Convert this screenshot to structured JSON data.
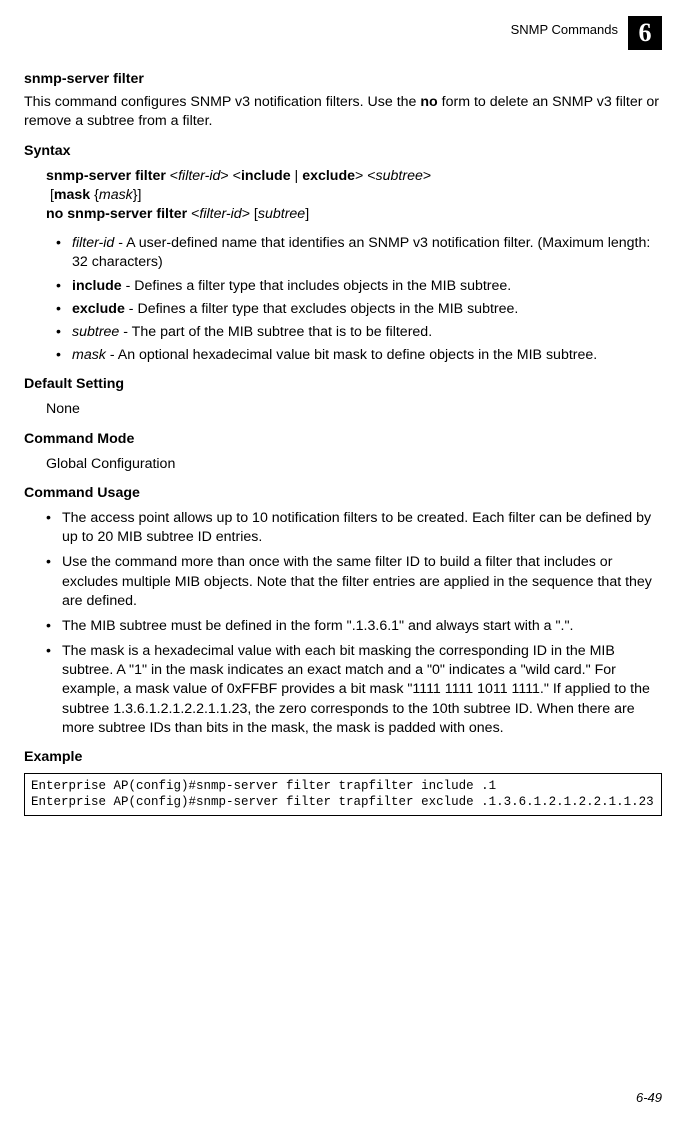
{
  "header": {
    "section": "SNMP Commands",
    "chapter": "6"
  },
  "title": "snmp-server filter",
  "intro_a": "This command configures SNMP v3 notification filters. Use the ",
  "intro_b": "no",
  "intro_c": " form to delete an SNMP v3 filter or remove a subtree from a filter.",
  "labels": {
    "syntax": "Syntax",
    "default": "Default Setting",
    "mode": "Command Mode",
    "usage": "Command Usage",
    "example": "Example"
  },
  "syntax": {
    "l1_a": "snmp-server filter",
    "l1_b": "filter-id",
    "l1_c": "include",
    "l1_d": "exclude",
    "l1_e": "subtree",
    "l2_a": "mask",
    "l2_b": "mask",
    "l3_a": "no snmp-server filter",
    "l3_b": "filter-id",
    "l3_c": "subtree"
  },
  "params": {
    "p1_a": "filter-id",
    "p1_b": " - A user-defined name that identifies an SNMP v3 notification filter. (Maximum length: 32 characters)",
    "p2_a": "include",
    "p2_b": " - Defines a filter type that includes objects in the MIB subtree.",
    "p3_a": "exclude",
    "p3_b": " - Defines a filter type that excludes objects in the MIB subtree.",
    "p4_a": "subtree",
    "p4_b": " - The part of the MIB subtree that is to be filtered.",
    "p5_a": "mask",
    "p5_b": " - An optional hexadecimal value bit mask to define objects in the MIB subtree."
  },
  "default_value": "None",
  "mode_value": "Global Configuration",
  "usage": {
    "u1": "The access point allows up to 10 notification filters to be created. Each filter can be defined by up to 20 MIB subtree ID entries.",
    "u2": "Use the command more than once with the same filter ID to build a filter that includes or excludes multiple MIB objects. Note that the filter entries are applied in the sequence that they are defined.",
    "u3": "The MIB subtree must be defined in the form \".1.3.6.1\" and always start with a \".\".",
    "u4": "The mask is a hexadecimal value with each bit masking the corresponding ID in the MIB subtree. A \"1\" in the mask indicates an exact match and a \"0\" indicates a \"wild card.\" For example, a mask value of 0xFFBF provides a bit mask \"1111 1111 1011 1111.\" If applied to the subtree 1.3.6.1.2.1.2.2.1.1.23, the zero corresponds to the 10th subtree ID. When there are more subtree IDs than bits in the mask, the mask is padded with ones."
  },
  "example_code": "Enterprise AP(config)#snmp-server filter trapfilter include .1\nEnterprise AP(config)#snmp-server filter trapfilter exclude .1.3.6.1.2.1.2.2.1.1.23",
  "page_number": "6-49"
}
